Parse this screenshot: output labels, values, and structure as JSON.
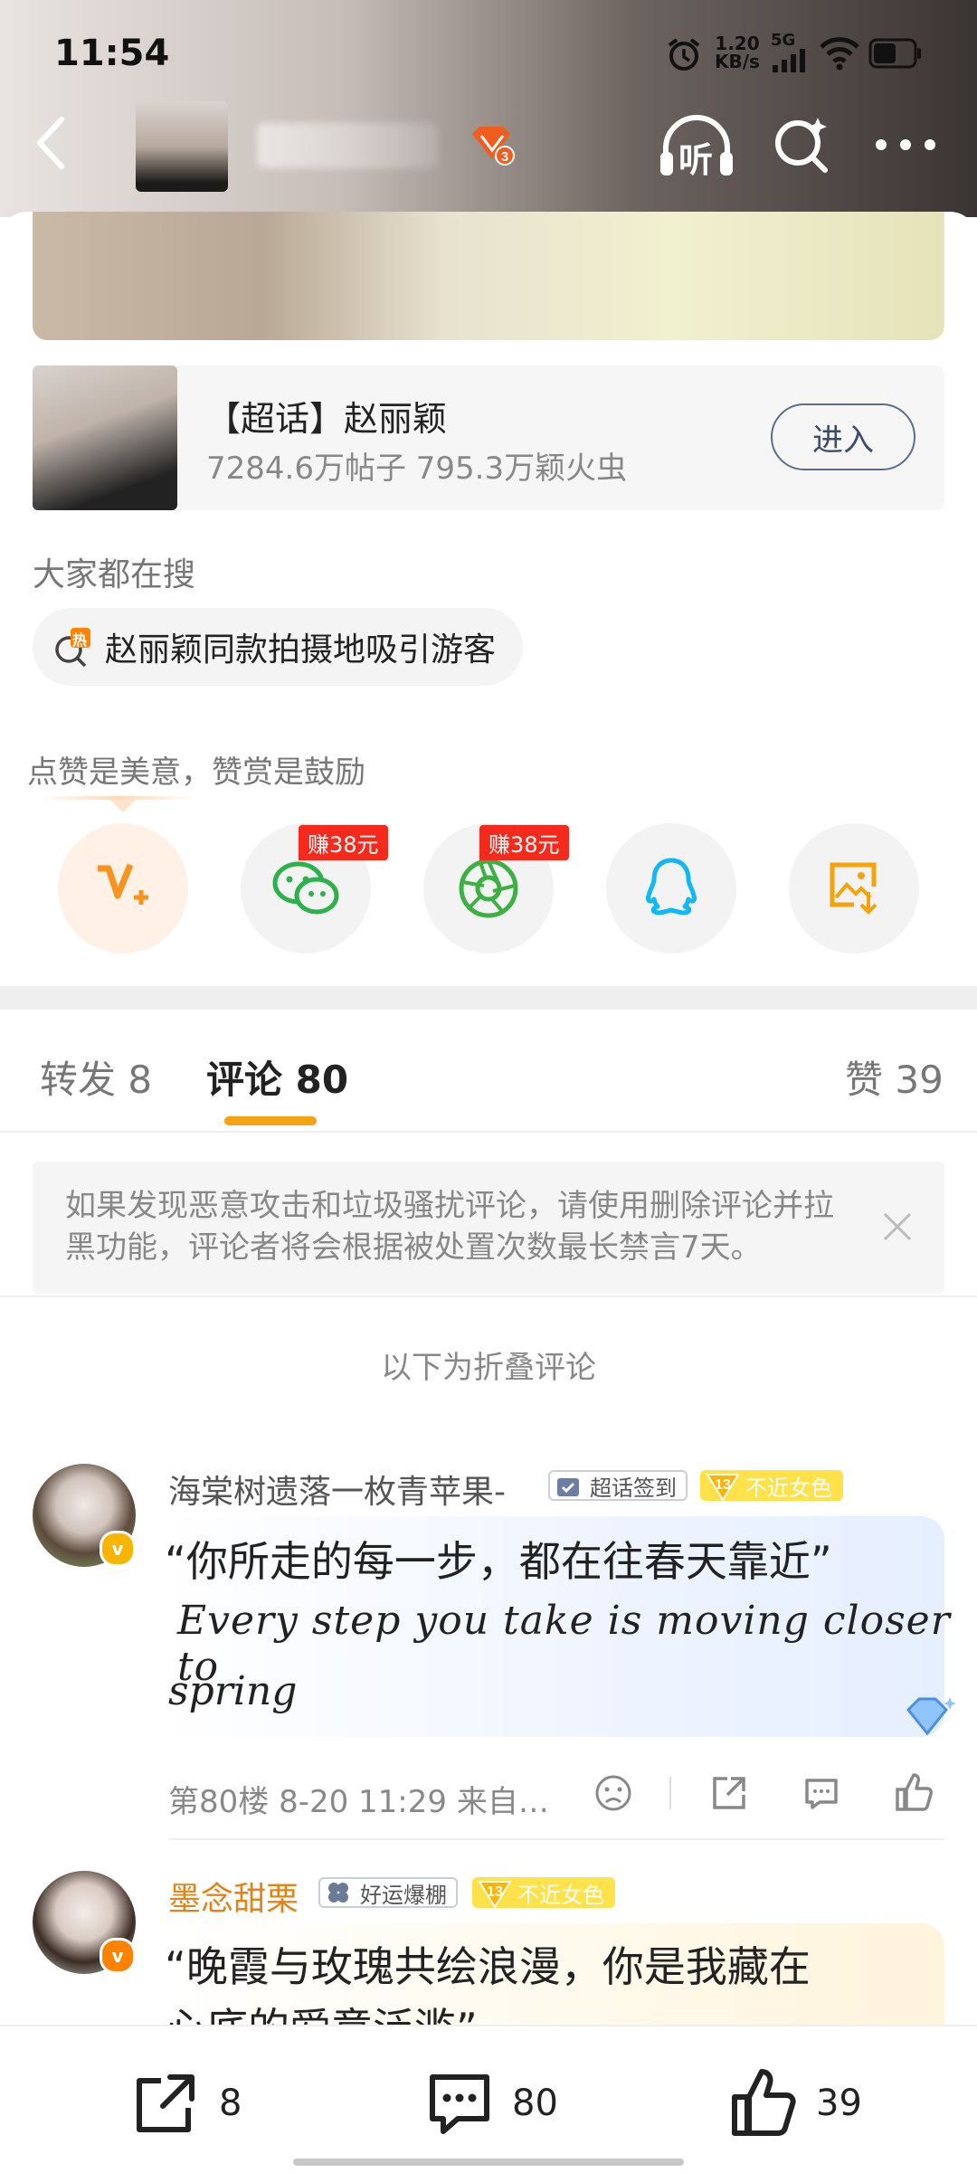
{
  "status_bar": {
    "time": "11:54",
    "net_speed_value": "1.20",
    "net_speed_unit": "KB/s",
    "signal": "5G"
  },
  "header": {
    "vip_level": "3",
    "listen_label": "听"
  },
  "topic": {
    "title": "【超话】赵丽颖",
    "stats": "7284.6万帖子 795.3万颖火虫",
    "enter_label": "进入"
  },
  "search_section": {
    "label": "大家都在搜",
    "hot_tag": "热",
    "chip_text": "赵丽颖同款拍摄地吸引游客"
  },
  "reward": {
    "label": "点赞是美意，赞赏是鼓励",
    "share_targets": [
      {
        "name": "weibo-v-plus",
        "badge": ""
      },
      {
        "name": "wechat",
        "badge": "赚38元"
      },
      {
        "name": "moments",
        "badge": "赚38元"
      },
      {
        "name": "qq",
        "badge": ""
      },
      {
        "name": "save-image",
        "badge": ""
      }
    ]
  },
  "tabs": {
    "repost": "转发 8",
    "comment": "评论 80",
    "like": "赞 39"
  },
  "notice": {
    "text": "如果发现恶意攻击和垃圾骚扰评论，请使用删除评论并拉黑功能，评论者将会根据被处置次数最长禁言7天。"
  },
  "folded_label": "以下为折叠评论",
  "comments": [
    {
      "user": "海棠树遗落一枚青苹果-",
      "badge_1": "超话签到",
      "badge_2_level": "13",
      "badge_2": "不近女色",
      "quote": "“你所走的每一步，都在往春天靠近”",
      "script_line_1": "Every step you take is moving closer to",
      "script_line_2": "spring",
      "meta": "第80楼 8-20 11:29 来自…"
    },
    {
      "user": "墨念甜栗",
      "badge_1": "好运爆棚",
      "badge_2_level": "13",
      "badge_2": "不近女色",
      "quote_line_1": "“晚霞与玫瑰共绘浪漫，你是我藏在",
      "quote_line_2": "心底的爱意泛滥”"
    }
  ],
  "bottom_bar": {
    "repost_count": "8",
    "comment_count": "80",
    "like_count": "39"
  },
  "colors": {
    "accent_orange": "#f7a212",
    "red_badge": "#f52a1d",
    "gold_username": "#e0841a"
  }
}
